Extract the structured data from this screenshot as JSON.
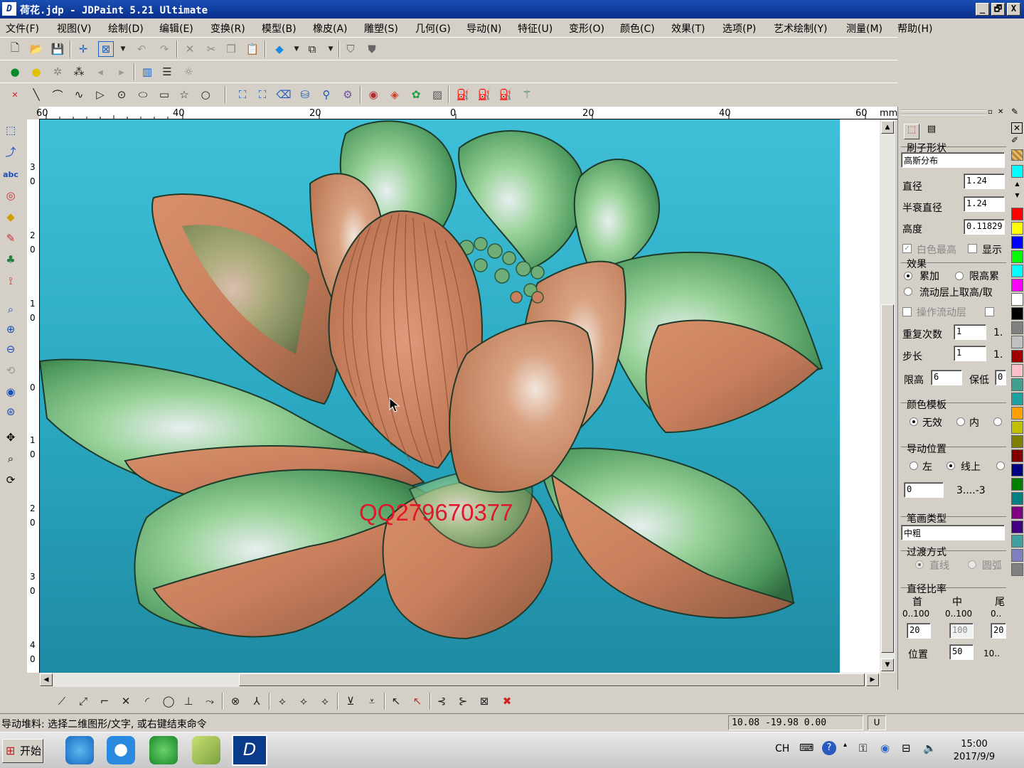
{
  "window": {
    "title": "荷花.jdp - JDPaint 5.21 Ultimate",
    "logo": "D",
    "min_label": "_",
    "max_label": "🗗",
    "close_label": "X"
  },
  "menu": [
    "文件(F)",
    "视图(V)",
    "绘制(D)",
    "编辑(E)",
    "变换(R)",
    "模型(B)",
    "橡皮(A)",
    "雕塑(S)",
    "几何(G)",
    "导动(N)",
    "特征(U)",
    "变形(O)",
    "颜色(C)",
    "效果(T)",
    "选项(P)",
    "艺术绘制(Y)",
    "测量(M)",
    "帮助(H)"
  ],
  "ruler": {
    "unit": "mm",
    "top_ticks": [
      "60",
      "40",
      "20",
      "0",
      "20",
      "40",
      "60"
    ],
    "left_ticks": [
      "3",
      "0",
      "2",
      "0",
      "1",
      "0",
      "0",
      "1",
      "0",
      "2",
      "0",
      "3",
      "0",
      "4",
      "0"
    ]
  },
  "canvas": {
    "watermark": "QQ279670377"
  },
  "panel": {
    "brush_shape_label": "刷子形状",
    "brush_shape_value": "高斯分布",
    "diameter_label": "直径",
    "diameter_value": "1.24",
    "half_decay_label": "半衰直径",
    "half_decay_value": "1.24",
    "height_label": "高度",
    "height_value": "0.11829",
    "white_highest_label": "白色最高",
    "show_label": "显示",
    "effect_label": "效果",
    "accumulate_label": "累加",
    "limit_height_label": "限高累",
    "flow_layer_label": "流动层上取高/取",
    "operate_flow_label": "操作流动层",
    "repeat_label": "重复次数",
    "repeat_value": "1",
    "repeat_extra": "1.",
    "step_label": "步长",
    "step_value": "1",
    "step_extra": "1.",
    "limit_label": "限高",
    "limit_value": "6",
    "keep_low_label": "保低",
    "keep_low_value": "0",
    "color_template_label": "颜色模板",
    "none_label": "无效",
    "inner_label": "内",
    "guide_pos_label": "导动位置",
    "left_label": "左",
    "online_label": "线上",
    "guide_value": "0",
    "guide_range": "3....-3",
    "stroke_type_label": "笔画类型",
    "stroke_type_value": "中粗",
    "transition_label": "过渡方式",
    "straight_label": "直线",
    "arc_label": "圆弧",
    "ratio_label": "直径比率",
    "head_label": "首",
    "mid_label": "中",
    "tail_label": "尾",
    "range_head": "0..100",
    "range_mid": "0..100",
    "range_tail": "0..",
    "head_value": "20",
    "mid_value": "100",
    "tail_value": "20",
    "position_label": "位置",
    "position_value": "50",
    "position_range": "10.."
  },
  "status": {
    "message": "导动堆料: 选择二维图形/文字, 或右键结束命令",
    "coords": "10.08 -19.98 0.00",
    "unit_flag": "U"
  },
  "taskbar": {
    "start_label": "开始",
    "lang": "CH",
    "time": "15:00",
    "date": "2017/9/9"
  },
  "palette": [
    "#ffffff",
    "#808080",
    "#00ffff",
    "#ff0000",
    "#ffff00",
    "#0000ff",
    "#00ff00",
    "#00ffff",
    "#ff00ff",
    "#ffffff",
    "#000000",
    "#808080",
    "#c0c0c0",
    "#a00000",
    "#ffc0cb",
    "#40a090",
    "#20a0a0",
    "#ffa000",
    "#c0c000",
    "#808000",
    "#800000",
    "#000080",
    "#008000",
    "#008080",
    "#800080",
    "#400080",
    "#40a0a0",
    "#8080c0",
    "#808080"
  ]
}
